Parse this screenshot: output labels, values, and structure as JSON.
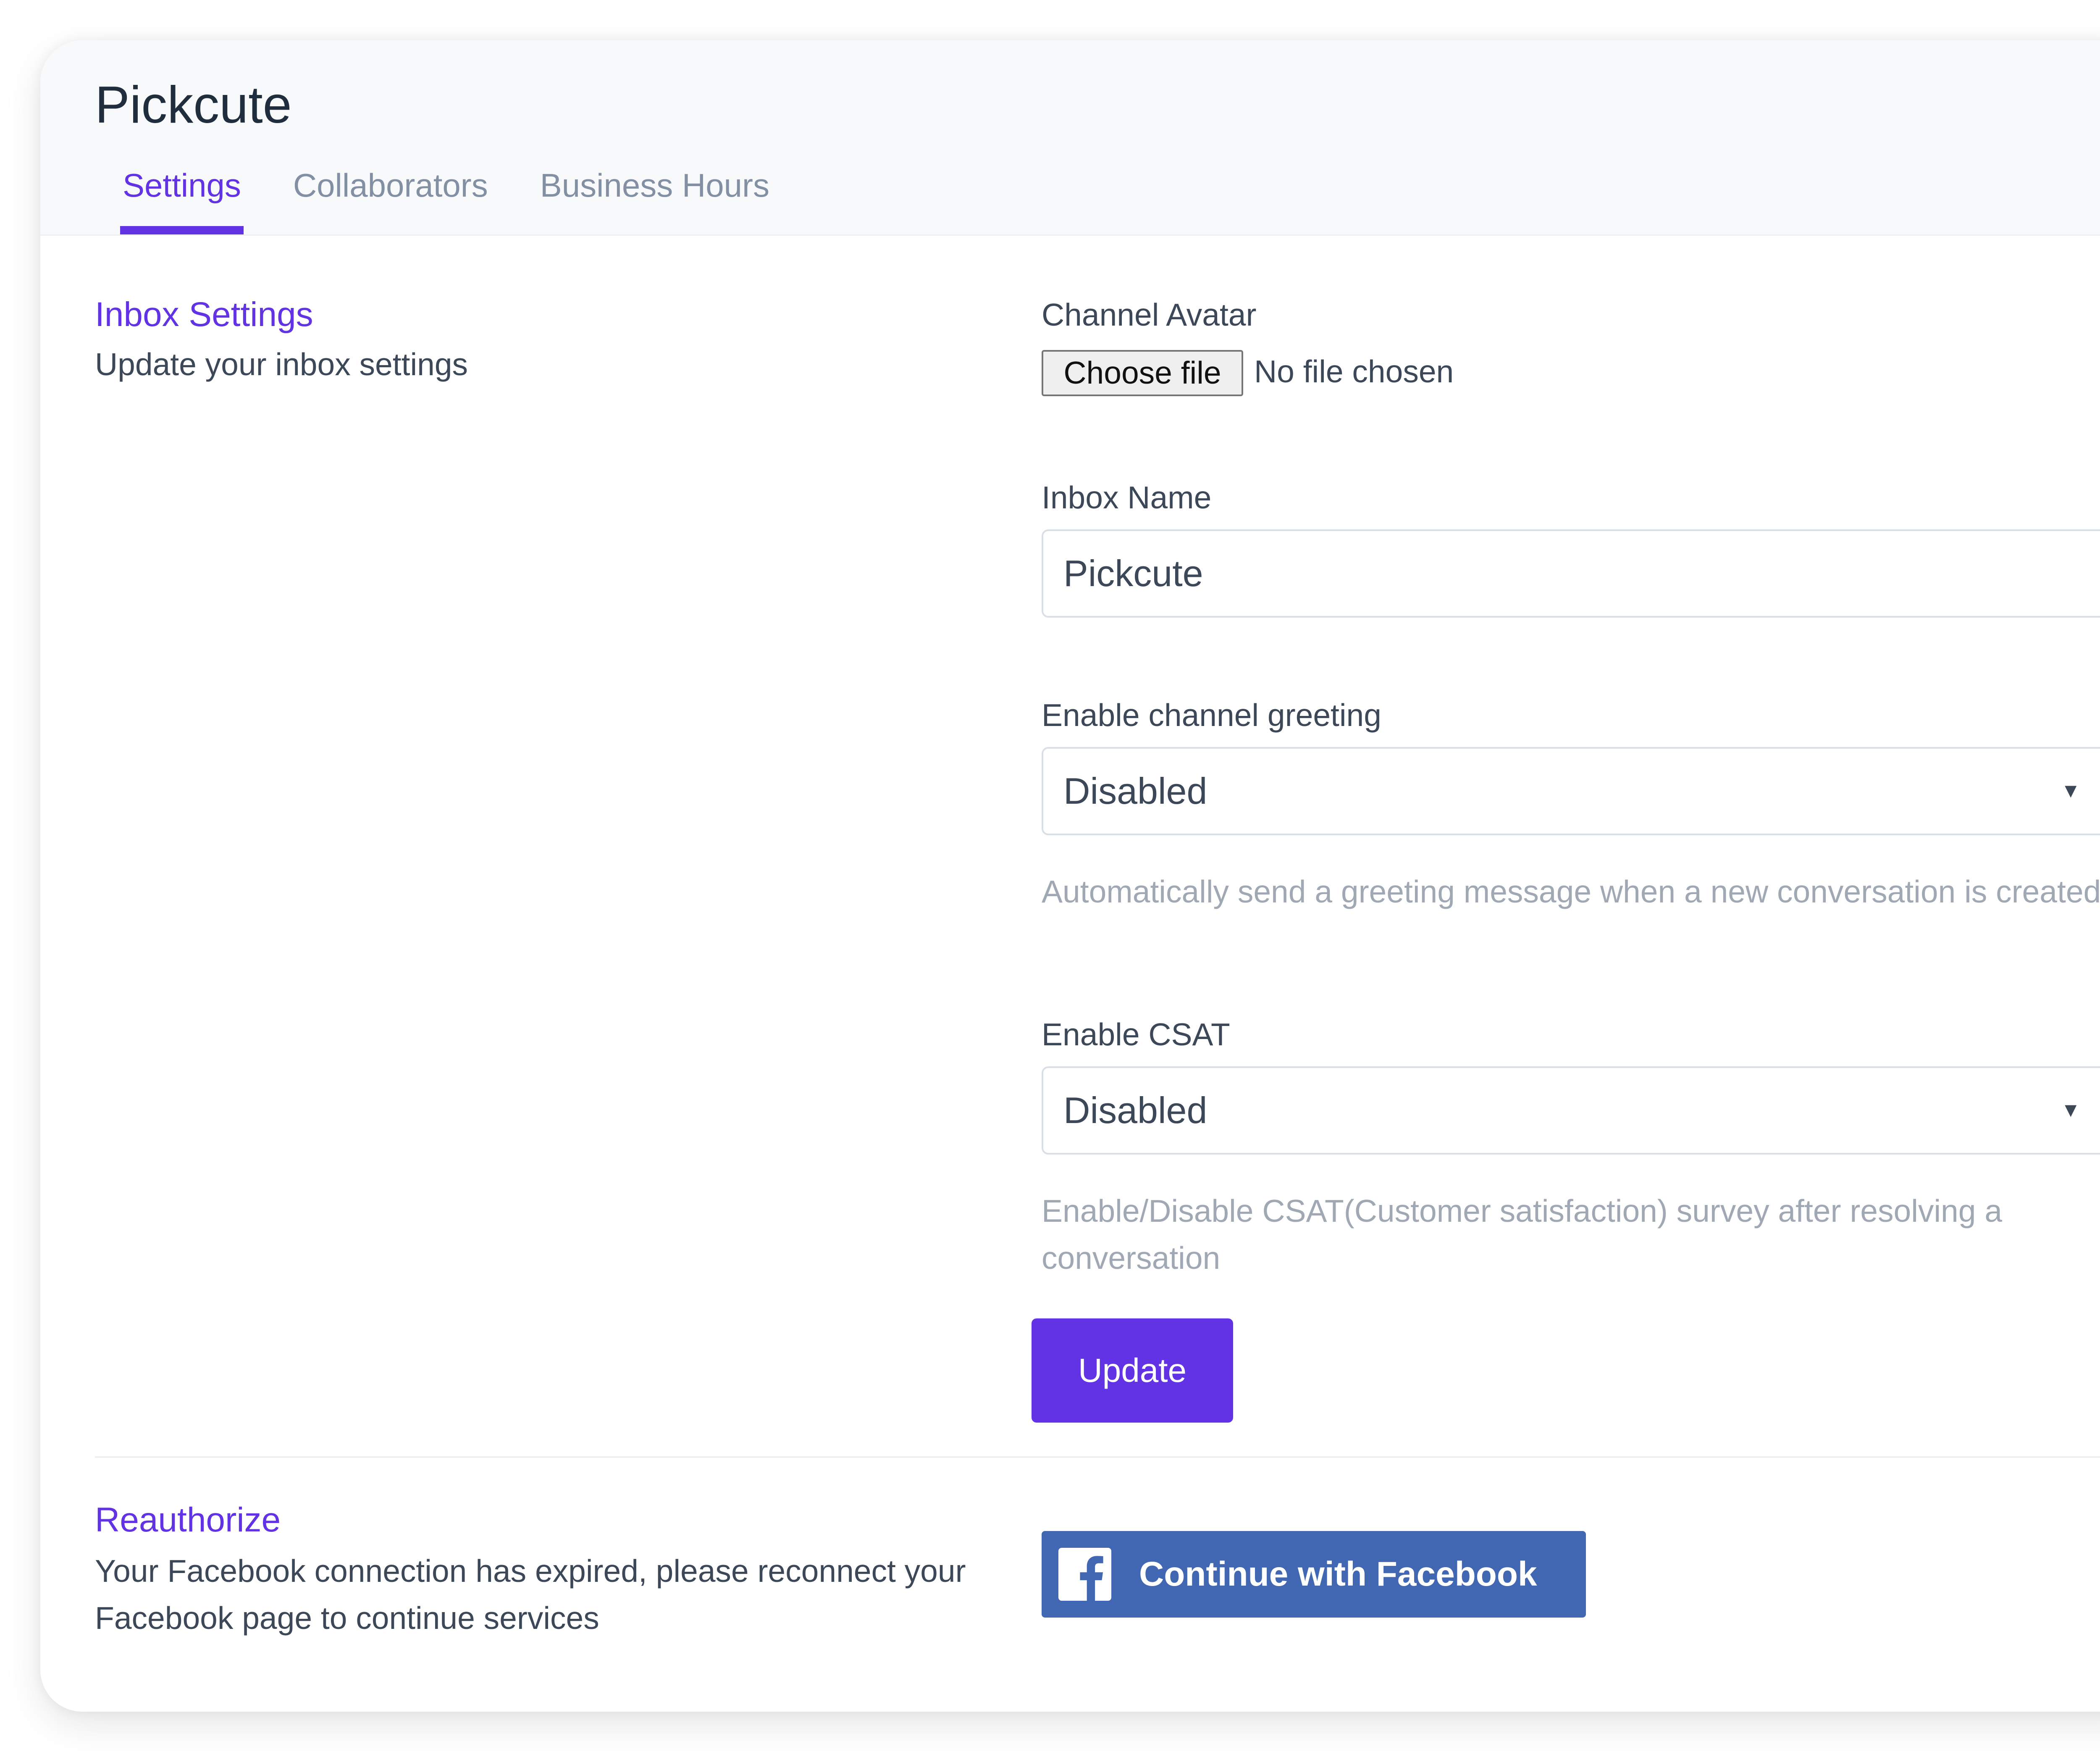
{
  "page": {
    "title": "Pickcute"
  },
  "tabs": [
    {
      "label": "Settings",
      "active": true
    },
    {
      "label": "Collaborators",
      "active": false
    },
    {
      "label": "Business Hours",
      "active": false
    }
  ],
  "inbox_settings": {
    "title": "Inbox Settings",
    "description": "Update your inbox settings"
  },
  "form": {
    "channel_avatar": {
      "label": "Channel Avatar",
      "button_label": "Choose file",
      "status": "No file chosen"
    },
    "inbox_name": {
      "label": "Inbox Name",
      "value": "Pickcute"
    },
    "channel_greeting": {
      "label": "Enable channel greeting",
      "value": "Disabled",
      "help": "Automatically send a greeting message when a new conversation is created."
    },
    "csat": {
      "label": "Enable CSAT",
      "value": "Disabled",
      "help": "Enable/Disable CSAT(Customer satisfaction) survey after resolving a conversation"
    },
    "update_label": "Update"
  },
  "reauthorize": {
    "title": "Reauthorize",
    "description": "Your Facebook connection has expired, please reconnect your Facebook page to continue services",
    "facebook_button_label": "Continue with Facebook"
  },
  "colors": {
    "accent": "#6133e4",
    "facebook": "#4267b2",
    "header_bg": "#f8f9fb"
  },
  "icons": {
    "select_arrow": "caret-down-icon",
    "facebook": "facebook-icon"
  }
}
